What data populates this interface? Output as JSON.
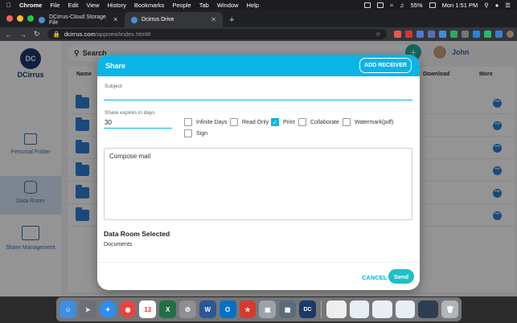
{
  "menubar": {
    "app": "Chrome",
    "items": [
      "File",
      "Edit",
      "View",
      "History",
      "Bookmarks",
      "People",
      "Tab",
      "Window",
      "Help"
    ],
    "battery": "55%",
    "clock": "Mon 1:51 PM"
  },
  "tabs": [
    {
      "title": "DCirrus-Cloud Storage File"
    },
    {
      "title": "Dcirrus Drive"
    }
  ],
  "address": {
    "host": "dcirrus.com",
    "path": "/appnew/index.html#"
  },
  "app": {
    "brand": "DCirrus",
    "logo_text": "DC",
    "nav": [
      {
        "label": "Personal Folder"
      },
      {
        "label": "Data Room"
      },
      {
        "label": "Share Management"
      }
    ],
    "search_label": "Search",
    "user_name": "John",
    "columns": {
      "name": "Name",
      "download": "Download",
      "more": "More"
    },
    "rows": [
      {},
      {},
      {},
      {},
      {},
      {}
    ]
  },
  "modal": {
    "title": "Share",
    "add_receiver": "ADD RECEIVER",
    "subject_label": "Subject",
    "expires_label": "Share expires in days",
    "expires_value": "30",
    "checkboxes": [
      {
        "label": "Infinite Days",
        "checked": false
      },
      {
        "label": "Read Only",
        "checked": false
      },
      {
        "label": "Print",
        "checked": true
      },
      {
        "label": "Collaborate",
        "checked": false
      },
      {
        "label": "Watermark(pdf)",
        "checked": false
      },
      {
        "label": "Sign",
        "checked": false
      }
    ],
    "compose_placeholder": "Compose mail",
    "dataroom_title": "Data Room Selected",
    "dataroom_item": "Documents",
    "cancel": "CANCEL",
    "send": "Send"
  },
  "dock": {
    "calendar_day": "13"
  },
  "colors": {
    "accent": "#09b4e6",
    "send": "#1dc1c6",
    "brand": "#1b3a6b",
    "folder": "#2f7fd6"
  }
}
